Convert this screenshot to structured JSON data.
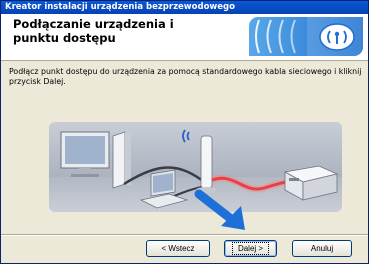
{
  "window": {
    "title": "Kreator instalacji urządzenia bezprzewodowego"
  },
  "header": {
    "heading": "Podłączanie urządzenia i punktu dostępu"
  },
  "instructions": "Podłącz punkt dostępu do urządzenia za pomocą standardowego kabla sieciowego i kliknij przycisk Dalej.",
  "buttons": {
    "back": "< Wstecz",
    "next": "Dalej >",
    "cancel": "Anuluj"
  },
  "colors": {
    "titlebar": "#0a58d8",
    "accent_blue": "#1f6fd0",
    "cable_red": "#e0202a",
    "arrow_blue": "#1e6fd8"
  },
  "icons": {
    "header_logo": "wireless-signal-icon",
    "illustration": "network-setup-illustration"
  }
}
